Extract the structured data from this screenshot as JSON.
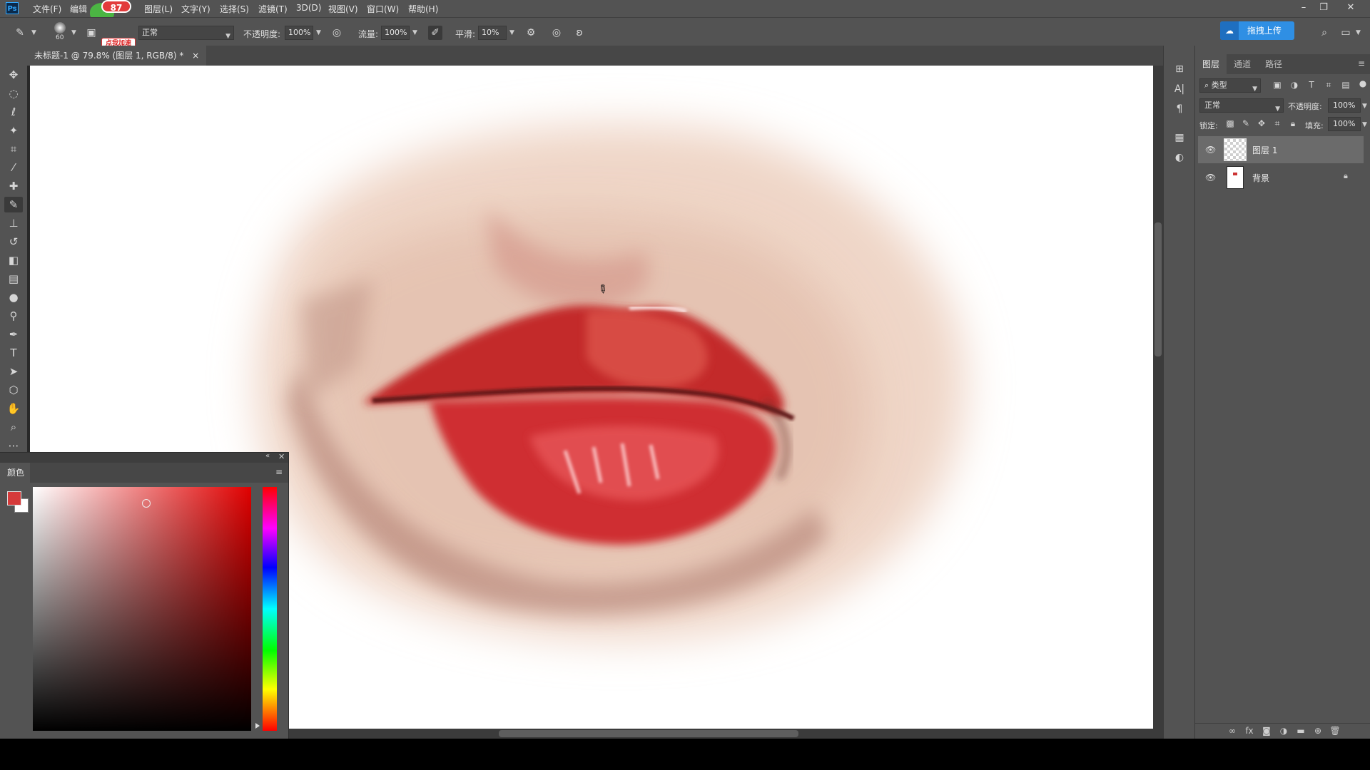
{
  "menubar": {
    "app_icon": "Ps",
    "items": [
      "文件(F)",
      "编辑",
      "图层(L)",
      "文字(Y)",
      "选择(S)",
      "滤镜(T)",
      "3D(D)",
      "视图(V)",
      "窗口(W)",
      "帮助(H)"
    ],
    "badge_count": "87",
    "accelerate_label": "点我加速",
    "window_controls": [
      "–",
      "❐",
      "✕"
    ]
  },
  "options": {
    "brush_size": "60",
    "blend_mode": "正常",
    "opacity_label": "不透明度:",
    "opacity_value": "100%",
    "flow_label": "流量:",
    "flow_value": "100%",
    "smoothing_label": "平滑:",
    "smoothing_value": "10%",
    "upload_label": "拖拽上传"
  },
  "document": {
    "tab_title": "未标题-1 @ 79.8% (图层 1, RGB/8) *",
    "close": "×"
  },
  "color_panel": {
    "tab_label": "颜色",
    "foreground": "#d53a3a",
    "background": "#ffffff"
  },
  "layers_panel": {
    "tabs": [
      "图层",
      "通道",
      "路径"
    ],
    "filter_kind": "类型",
    "blend_mode": "正常",
    "opacity_label": "不透明度:",
    "opacity_value": "100%",
    "lock_label": "锁定:",
    "fill_label": "填充:",
    "fill_value": "100%",
    "layers": [
      {
        "name": "图层 1",
        "selected": true
      },
      {
        "name": "背景",
        "selected": false,
        "locked": true
      }
    ]
  },
  "icons": {
    "tools": [
      "move-icon",
      "marquee-icon",
      "lasso-icon",
      "magic-wand-icon",
      "crop-icon",
      "eyedropper-icon",
      "healing-icon",
      "brush-icon",
      "stamp-icon",
      "history-brush-icon",
      "eraser-icon",
      "gradient-icon",
      "blur-icon",
      "dodge-icon",
      "pen-icon",
      "type-icon",
      "path-select-icon",
      "shape-icon",
      "hand-icon",
      "zoom-icon",
      "more-icon"
    ]
  }
}
